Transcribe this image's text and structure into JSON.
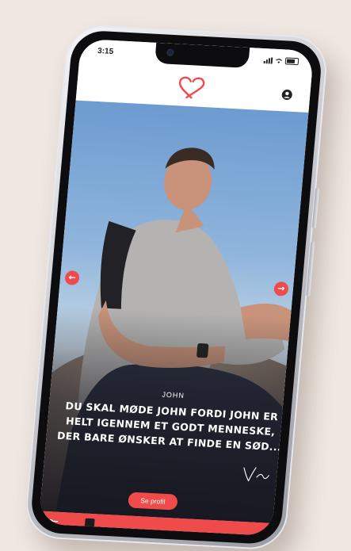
{
  "status_bar": {
    "time": "3:15"
  },
  "profile_card": {
    "name": "JOHN",
    "description": "DU SKAL MØDE JOHN FORDI JOHN ER HELT IGENNEM ET GODT MENNESKE, DER BARE ØNSKER AT FINDE EN SØD...",
    "cta_label": "Se profil"
  },
  "colors": {
    "accent": "#ef4b4b",
    "background": "#efe7e1",
    "header_bg": "#ffffff"
  },
  "icons": {
    "logo": "heart-logo-icon",
    "profile": "user-icon",
    "prev": "arrow-left-icon",
    "next": "arrow-right-icon",
    "filter": "sliders-icon"
  }
}
